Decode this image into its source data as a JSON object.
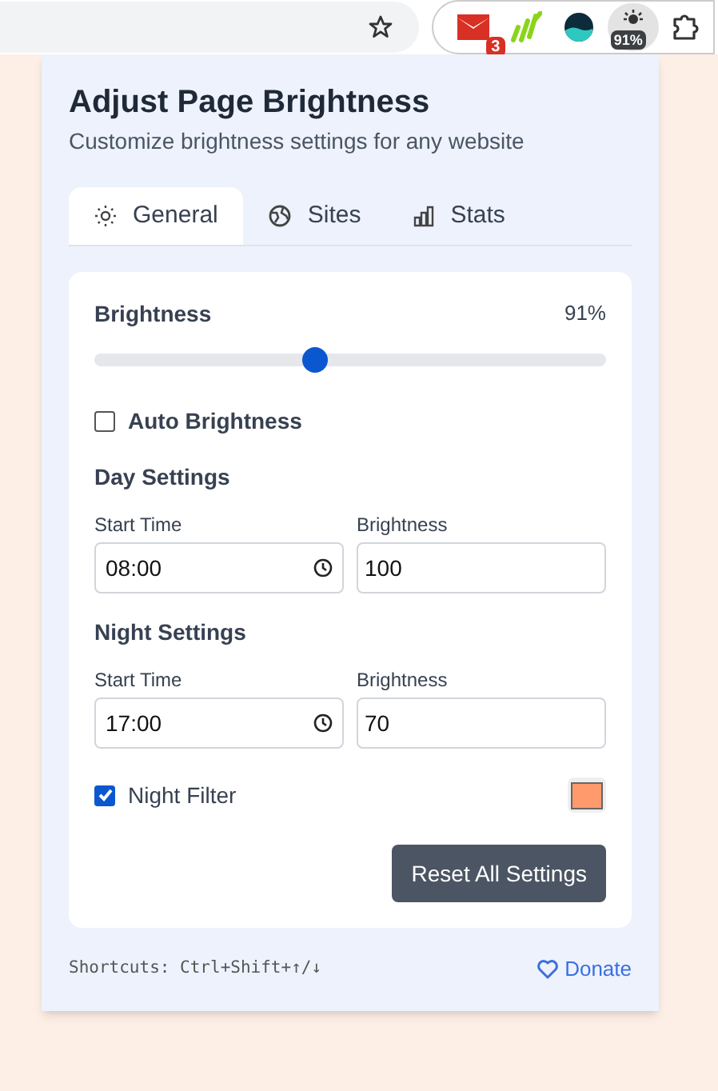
{
  "toolbar": {
    "extensions": [
      {
        "kind": "mail",
        "badge": "3"
      },
      {
        "kind": "bars"
      },
      {
        "kind": "wave"
      },
      {
        "kind": "brightness",
        "badge": "91%",
        "selected": true
      },
      {
        "kind": "puzzle"
      }
    ]
  },
  "popup": {
    "title": "Adjust Page Brightness",
    "subtitle": "Customize brightness settings for any website",
    "tabs": [
      {
        "label": "General",
        "kind": "sun",
        "selected": true
      },
      {
        "label": "Sites",
        "kind": "globe",
        "selected": false
      },
      {
        "label": "Stats",
        "kind": "chart",
        "selected": false
      }
    ],
    "brightness": {
      "label": "Brightness",
      "reading": "91%",
      "level": 0.43
    },
    "auto_brightness": {
      "label": "Auto Brightness",
      "checked": false
    },
    "groups": [
      {
        "title": "Day Settings",
        "start_label": "Start Time",
        "start_value": "08:00",
        "brightness_label": "Brightness",
        "brightness_value": "100"
      },
      {
        "title": "Night Settings",
        "start_label": "Start Time",
        "start_value": "17:00",
        "brightness_label": "Brightness",
        "brightness_value": "70"
      }
    ],
    "night_filter": {
      "label": "Night Filter",
      "checked": true,
      "color": "#ff9a6c"
    },
    "reset_button": "Reset All Settings",
    "shortcuts": "Shortcuts: Ctrl+Shift+↑/↓",
    "donate": "Donate"
  }
}
